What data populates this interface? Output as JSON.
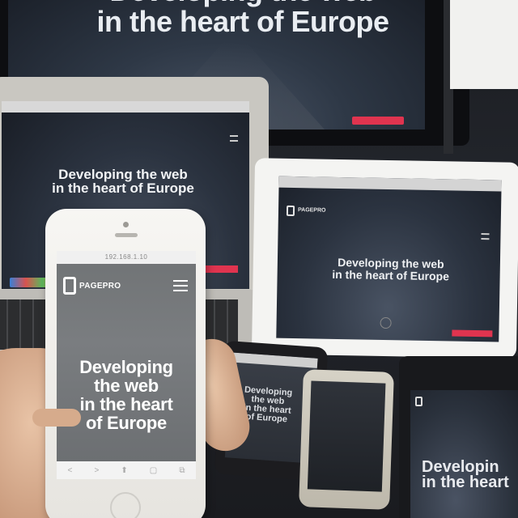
{
  "scene": {
    "headline": "Developing the web in the heart of Europe",
    "brand": "PAGEPRO"
  },
  "monitor": {
    "headline_line1": "Developing the web",
    "headline_line2": "in the heart of Europe"
  },
  "laptop": {
    "headline_line1": "Developing the web",
    "headline_line2": "in the heart of Europe"
  },
  "ipad": {
    "brand": "PAGEPRO",
    "headline_line1": "Developing the web",
    "headline_line2": "in the heart of Europe"
  },
  "android": {
    "headline_line1": "Developing",
    "headline_line2": "the web",
    "headline_line3": "in the heart",
    "headline_line4": "of Europe"
  },
  "tablet2": {
    "headline_line1": "Developin",
    "headline_line2": "in the heart"
  },
  "iphone": {
    "url": "192.168.1.10",
    "brand": "PAGEPRO",
    "headline_line1": "Developing",
    "headline_line2": "the web",
    "headline_line3": "in the heart",
    "headline_line4": "of Europe",
    "nav": [
      "<",
      ">",
      "⬆",
      "▢",
      "⧉"
    ]
  }
}
